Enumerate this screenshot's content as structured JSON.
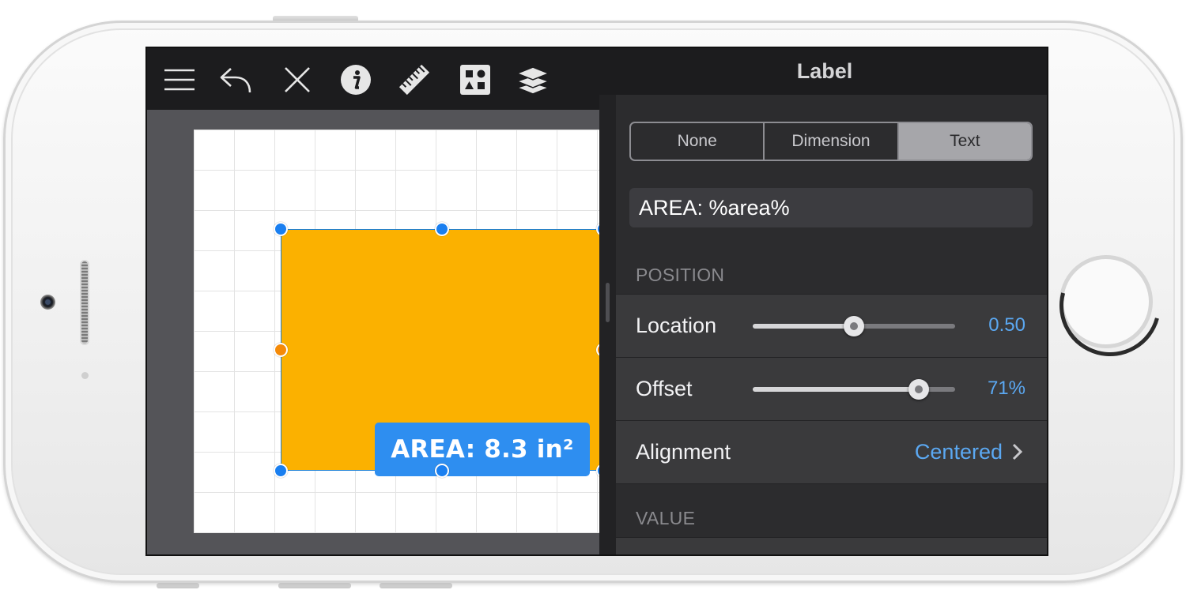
{
  "toolbar": {
    "icons": [
      "menu-icon",
      "undo-icon",
      "close-icon",
      "info-icon",
      "ruler-icon",
      "shapes-icon",
      "layers-icon"
    ]
  },
  "canvas": {
    "label_text": "AREA: 8.3 in²",
    "shape_color": "#fbb100",
    "label_color": "#2e8ef0",
    "handle_color": "#1a7ff0",
    "midpoint_handle_color": "#f58a07"
  },
  "inspector": {
    "title": "Label",
    "segments": [
      "None",
      "Dimension",
      "Text"
    ],
    "selected_segment": "Text",
    "text_value": "AREA: %area%",
    "position_section": "POSITION",
    "location": {
      "label": "Location",
      "value": "0.50",
      "fraction": 0.5
    },
    "offset": {
      "label": "Offset",
      "value": "71%",
      "fraction": 0.82
    },
    "alignment": {
      "label": "Alignment",
      "value": "Centered"
    },
    "value_section": "VALUE",
    "accent_color": "#5ba8f2"
  }
}
